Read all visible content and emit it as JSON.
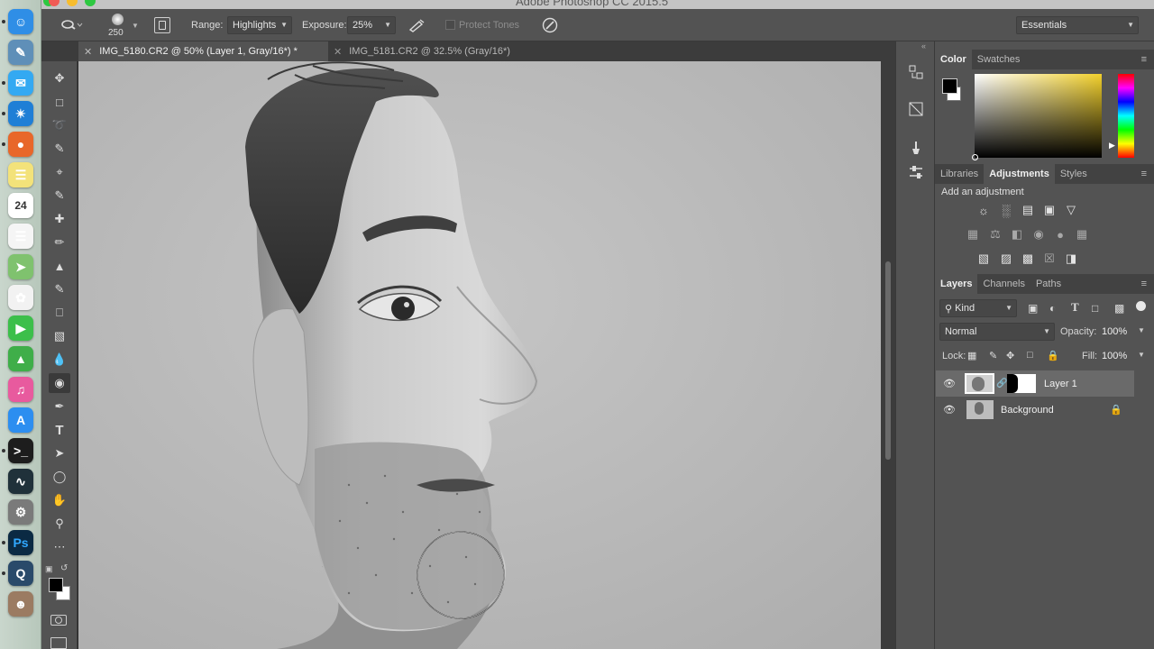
{
  "window": {
    "title": "Adobe Photoshop CC 2015.5"
  },
  "dock": {
    "items": [
      {
        "icon": "finder-icon",
        "color": "#2f8ee6"
      },
      {
        "icon": "preview-icon",
        "color": "#5f8fb8"
      },
      {
        "icon": "messages-icon",
        "color": "#33a9f2"
      },
      {
        "icon": "safari-icon",
        "color": "#1f7fd6"
      },
      {
        "icon": "firefox-icon",
        "color": "#e8672a"
      },
      {
        "icon": "notes-icon",
        "color": "#f3e27a"
      },
      {
        "icon": "calendar-icon",
        "color": "#ffffff",
        "label": "24"
      },
      {
        "icon": "reminders-icon",
        "color": "#f5f5f5"
      },
      {
        "icon": "maps-icon",
        "color": "#7fc26e"
      },
      {
        "icon": "photos-icon",
        "color": "#f2f2f2"
      },
      {
        "icon": "facetime-icon",
        "color": "#3cbf4a"
      },
      {
        "icon": "numbers-icon",
        "color": "#3fae49"
      },
      {
        "icon": "itunes-icon",
        "color": "#e85a9e"
      },
      {
        "icon": "app-store-icon",
        "color": "#2c8ef0"
      },
      {
        "icon": "terminal-icon",
        "color": "#1d1d1d"
      },
      {
        "icon": "activity-monitor-icon",
        "color": "#20313a"
      },
      {
        "icon": "system-preferences-icon",
        "color": "#7a7a7a"
      },
      {
        "icon": "photoshop-icon",
        "color": "#0b2a43",
        "label": "Ps"
      },
      {
        "icon": "quicktime-icon",
        "color": "#2a4a6a"
      },
      {
        "icon": "user-photo-icon",
        "color": "#9b7b62"
      }
    ]
  },
  "options_bar": {
    "brush_size": "250",
    "range_label": "Range:",
    "range_value": "Highlights",
    "exposure_label": "Exposure:",
    "exposure_value": "25%",
    "protect_tones": "Protect Tones",
    "workspace": "Essentials"
  },
  "document_tabs": [
    {
      "label": "IMG_5180.CR2 @ 50% (Layer 1, Gray/16*) *",
      "active": true
    },
    {
      "label": "IMG_5181.CR2 @ 32.5% (Gray/16*)",
      "active": false
    }
  ],
  "tools": [
    "move-tool-icon",
    "marquee-tool-icon",
    "lasso-tool-icon",
    "quick-select-tool-icon",
    "crop-tool-icon",
    "eyedropper-tool-icon",
    "healing-brush-tool-icon",
    "brush-tool-icon",
    "clone-stamp-tool-icon",
    "history-brush-tool-icon",
    "eraser-tool-icon",
    "gradient-tool-icon",
    "blur-tool-icon",
    "dodge-tool-icon",
    "pen-tool-icon",
    "type-tool-icon",
    "path-select-tool-icon",
    "ellipse-tool-icon",
    "hand-tool-icon",
    "zoom-tool-icon",
    "more-tools-icon"
  ],
  "color_panel": {
    "tabs": [
      "Color",
      "Swatches"
    ],
    "foreground": "#000000",
    "background": "#ffffff",
    "hue": "#f3d12c"
  },
  "adjustments_panel": {
    "tabs": [
      "Libraries",
      "Adjustments",
      "Styles"
    ],
    "active_tab": "Adjustments",
    "heading": "Add an adjustment"
  },
  "layers_panel": {
    "tabs": [
      "Layers",
      "Channels",
      "Paths"
    ],
    "filter_kind": "Kind",
    "blend_mode": "Normal",
    "opacity_label": "Opacity:",
    "opacity_value": "100%",
    "lock_label": "Lock:",
    "fill_label": "Fill:",
    "fill_value": "100%",
    "layers": [
      {
        "name": "Layer 1",
        "selected": true,
        "has_mask": true
      },
      {
        "name": "Background",
        "selected": false,
        "locked": true
      }
    ]
  }
}
